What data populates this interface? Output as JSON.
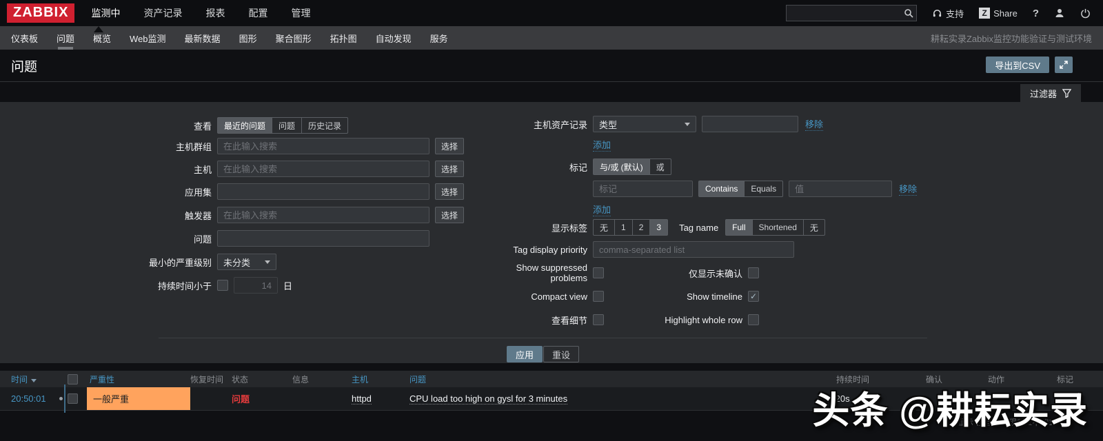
{
  "topbar": {
    "logo": "ZABBIX",
    "menu": [
      "监测中",
      "资产记录",
      "报表",
      "配置",
      "管理"
    ],
    "active_menu": "监测中",
    "search_value": "",
    "support_label": "支持",
    "share_badge": "Z",
    "share_label": "Share",
    "help_label": "?"
  },
  "subnav": {
    "items": [
      "仪表板",
      "问题",
      "概览",
      "Web监测",
      "最新数据",
      "图形",
      "聚合图形",
      "拓扑图",
      "自动发现",
      "服务"
    ],
    "active_item": "问题",
    "env_label": "耕耘实录Zabbix监控功能验证与测试环境"
  },
  "page": {
    "title": "问题",
    "export_csv_label": "导出到CSV",
    "filter_label": "过滤器"
  },
  "filter": {
    "left": {
      "view_label": "查看",
      "view_options": [
        "最近的问题",
        "问题",
        "历史记录"
      ],
      "view_active": "最近的问题",
      "host_group_label": "主机群组",
      "host_label": "主机",
      "application_label": "应用集",
      "trigger_label": "触发器",
      "problem_label": "问题",
      "search_placeholder": "在此输入搜索",
      "select_button": "选择",
      "min_severity_label": "最小的严重级别",
      "min_severity_value": "未分类",
      "age_label": "持续时间小于",
      "age_checked": false,
      "age_value": "14",
      "age_unit": "日"
    },
    "right": {
      "inventory_label": "主机资产记录",
      "inventory_type_value": "类型",
      "remove_label": "移除",
      "add_label": "添加",
      "tags_label": "标记",
      "logic_options": [
        "与/或 (默认)",
        "或"
      ],
      "logic_active": "与/或 (默认)",
      "tag_placeholder": "标记",
      "operator_options": [
        "Contains",
        "Equals"
      ],
      "operator_active": "Contains",
      "value_placeholder": "值",
      "show_tags_label": "显示标签",
      "show_tags_options": [
        "无",
        "1",
        "2",
        "3"
      ],
      "show_tags_active": "3",
      "tag_name_label": "Tag name",
      "tag_name_options": [
        "Full",
        "Shortened",
        "无"
      ],
      "tag_name_active": "Full",
      "priority_label": "Tag display priority",
      "priority_placeholder": "comma-separated list",
      "checkboxes": [
        {
          "label": "Show suppressed problems",
          "checked": false
        },
        {
          "label": "仅显示未确认",
          "checked": false
        },
        {
          "label": "Compact view",
          "checked": false
        },
        {
          "label": "Show timeline",
          "checked": true
        },
        {
          "label": "查看细节",
          "checked": false
        },
        {
          "label": "Highlight whole row",
          "checked": false
        }
      ]
    },
    "apply_button": "应用",
    "reset_button": "重设"
  },
  "table": {
    "columns": {
      "time": "时间",
      "severity": "严重性",
      "recovery": "恢复时间",
      "status": "状态",
      "info": "信息",
      "host": "主机",
      "problem": "问题",
      "duration": "持续时间",
      "ack": "确认",
      "actions": "动作",
      "tags": "标记"
    },
    "row": {
      "time": "20:50:01",
      "severity": "一般严重",
      "status": "问题",
      "host": "httpd",
      "problem": "CPU load too high on gysl for 3 minutes",
      "duration": "5m 20s"
    },
    "stats": "显示 已自动发现的 1中的1"
  },
  "watermark": "头条 @耕耘实录",
  "colors": {
    "logo_red": "#d02030",
    "accent_blue": "#4796c4",
    "severity_average_bg": "#ffa35d",
    "problem_status_red": "#e33b3c",
    "apply_button_bg": "#5f7a8b",
    "checkmark": "#a9bcc8"
  }
}
